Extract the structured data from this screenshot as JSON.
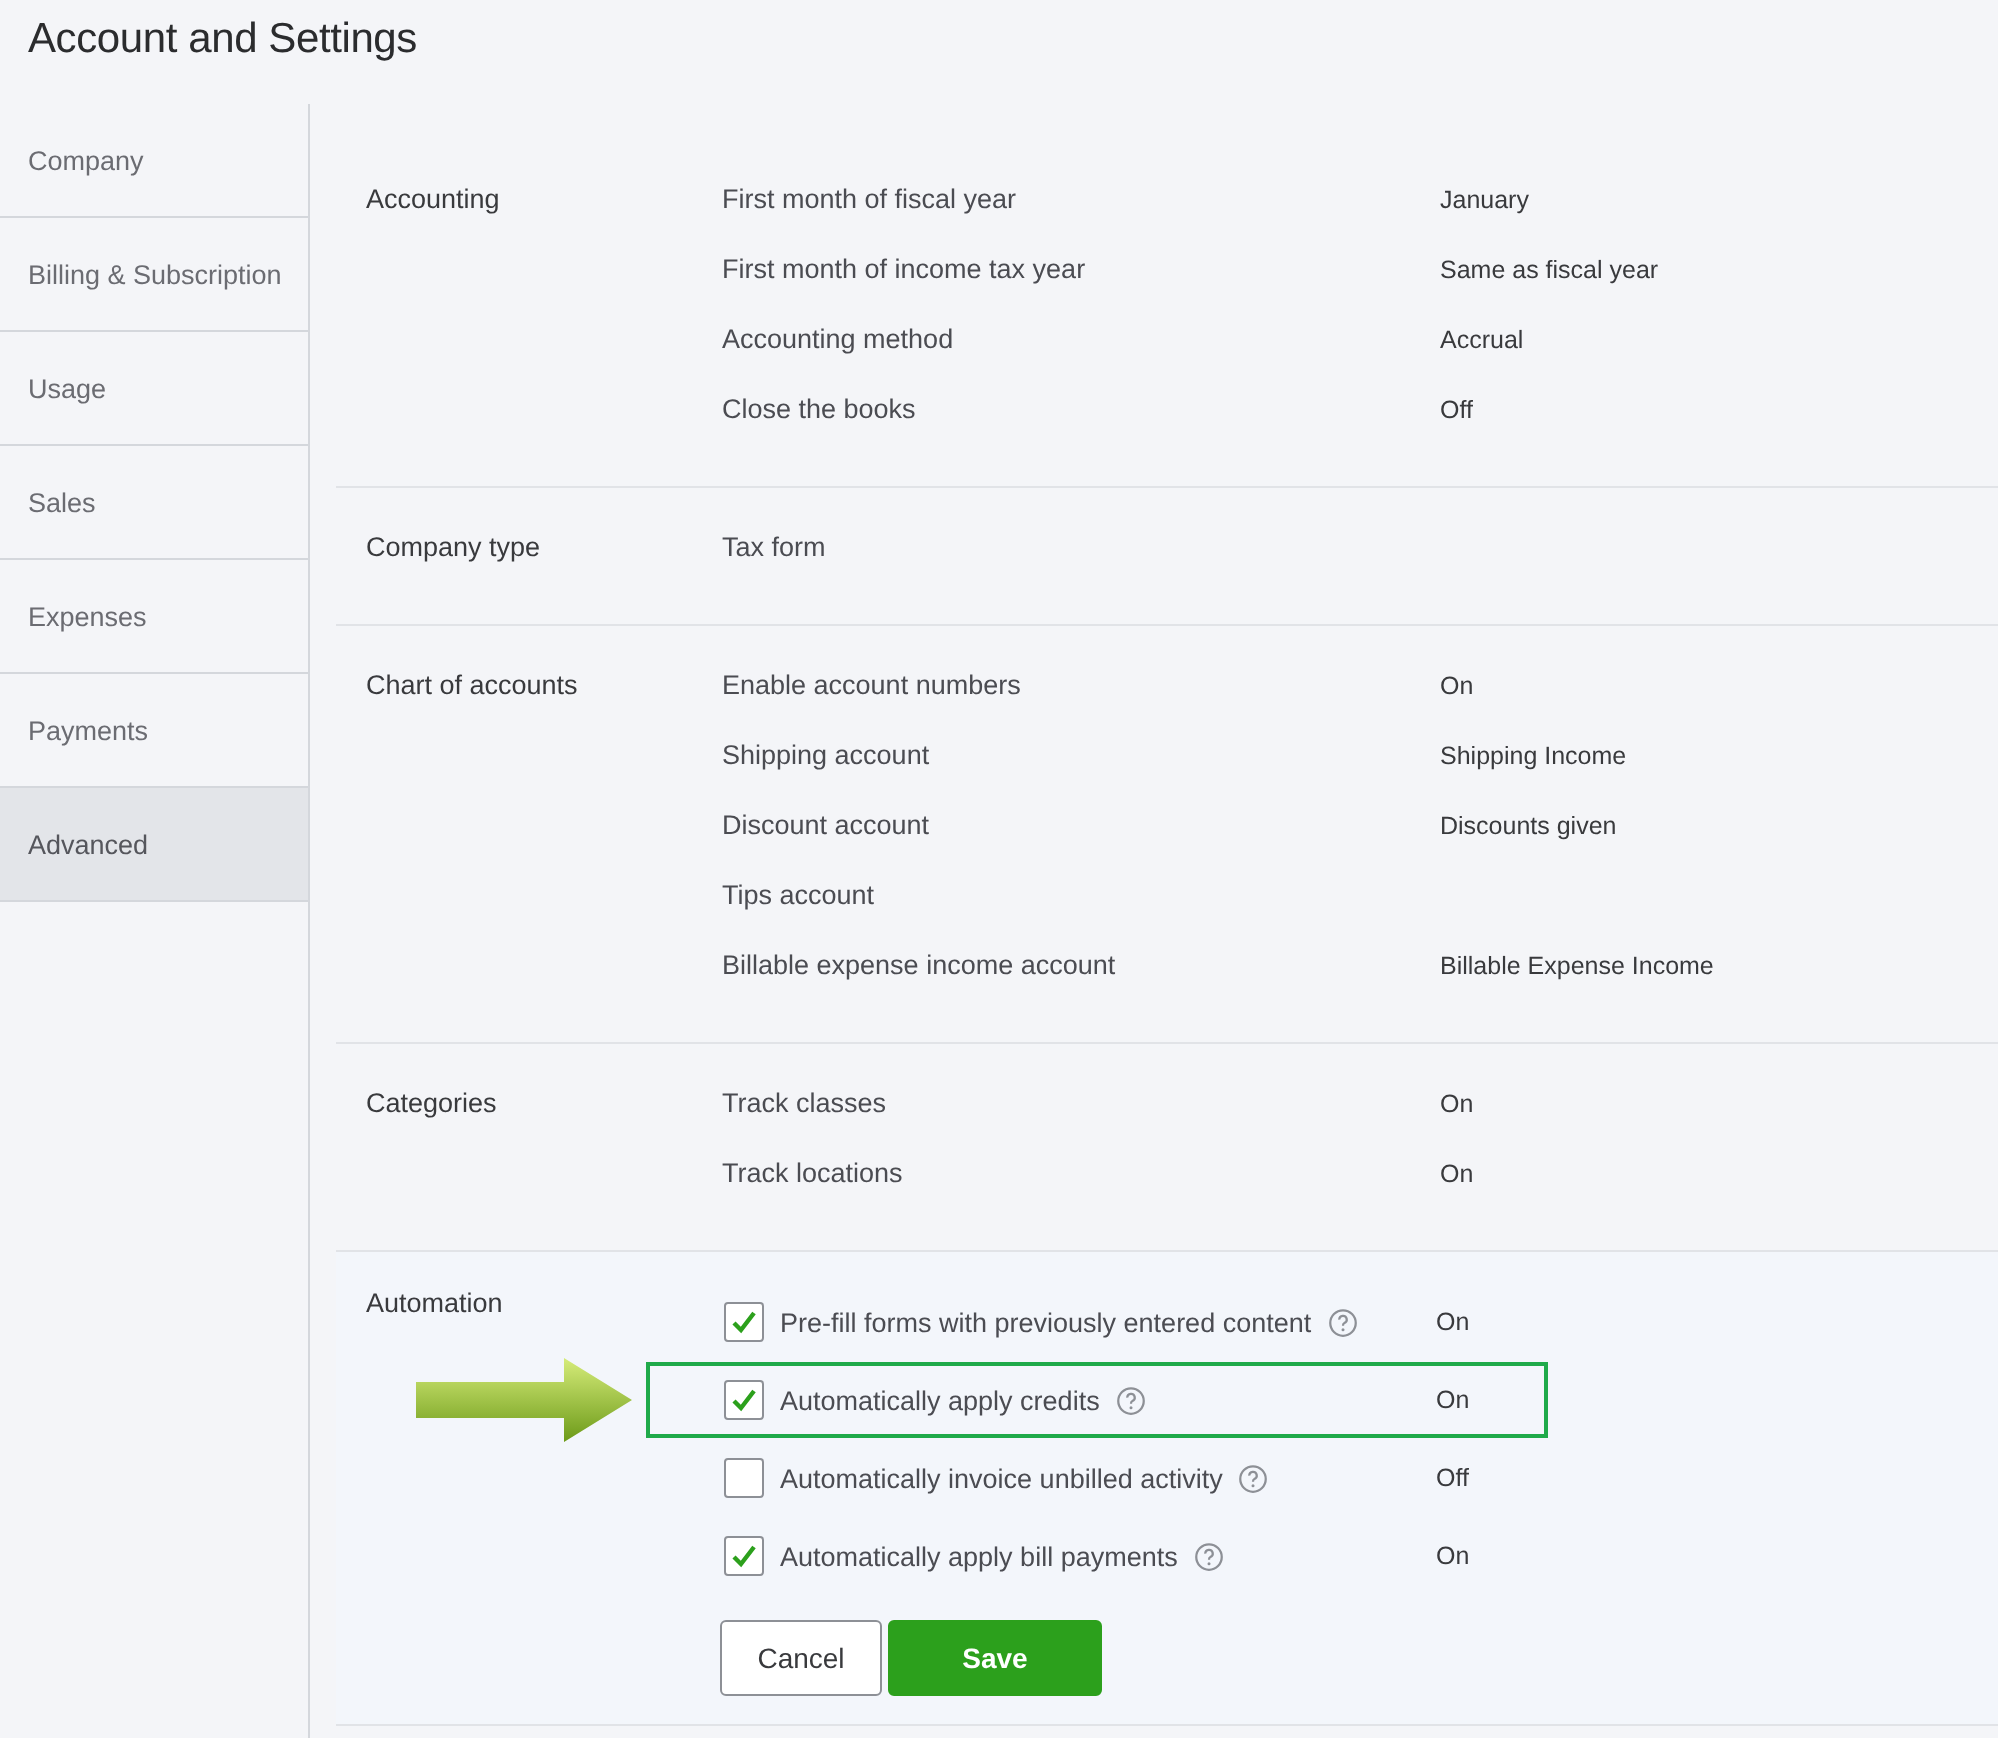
{
  "title": "Account and Settings",
  "sidebar": {
    "items": [
      {
        "label": "Company",
        "selected": false
      },
      {
        "label": "Billing & Subscription",
        "selected": false
      },
      {
        "label": "Usage",
        "selected": false
      },
      {
        "label": "Sales",
        "selected": false
      },
      {
        "label": "Expenses",
        "selected": false
      },
      {
        "label": "Payments",
        "selected": false
      },
      {
        "label": "Advanced",
        "selected": true
      }
    ]
  },
  "sections": [
    {
      "label": "Accounting",
      "rows": [
        {
          "setting": "First month of fiscal year",
          "value": "January"
        },
        {
          "setting": "First month of income tax year",
          "value": "Same as fiscal year"
        },
        {
          "setting": "Accounting method",
          "value": "Accrual"
        },
        {
          "setting": "Close the books",
          "value": "Off"
        }
      ]
    },
    {
      "label": "Company type",
      "rows": [
        {
          "setting": "Tax form"
        }
      ]
    },
    {
      "label": "Chart of accounts",
      "rows": [
        {
          "setting": "Enable account numbers",
          "value": "On"
        },
        {
          "setting": "Shipping account",
          "value": "Shipping Income"
        },
        {
          "setting": "Discount account",
          "value": "Discounts given"
        },
        {
          "setting": "Tips account"
        },
        {
          "setting": "Billable expense income account",
          "value": "Billable Expense Income"
        }
      ]
    },
    {
      "label": "Categories",
      "rows": [
        {
          "setting": "Track classes",
          "value": "On"
        },
        {
          "setting": "Track locations",
          "value": "On"
        }
      ]
    }
  ],
  "automation": {
    "label": "Automation",
    "options": [
      {
        "label": "Pre-fill forms with previously entered content",
        "checked": true,
        "value": "On",
        "highlighted": false
      },
      {
        "label": "Automatically apply credits",
        "checked": true,
        "value": "On",
        "highlighted": true
      },
      {
        "label": "Automatically invoice unbilled activity",
        "checked": false,
        "value": "Off",
        "highlighted": false
      },
      {
        "label": "Automatically apply bill payments",
        "checked": true,
        "value": "On",
        "highlighted": false
      }
    ],
    "buttons": [
      {
        "label": "Cancel",
        "kind": "secondary"
      },
      {
        "label": "Save",
        "kind": "primary"
      }
    ]
  }
}
